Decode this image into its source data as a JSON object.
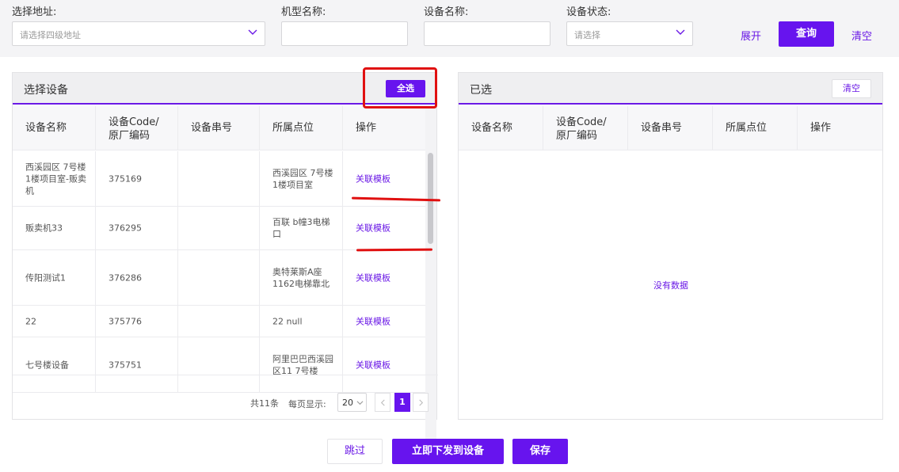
{
  "filters": {
    "address": {
      "label": "选择地址:",
      "placeholder": "请选择四级地址"
    },
    "model": {
      "label": "机型名称:",
      "value": ""
    },
    "device_name": {
      "label": "设备名称:",
      "value": ""
    },
    "status": {
      "label": "设备状态:",
      "placeholder": "请选择"
    },
    "expand_label": "展开",
    "query_label": "查询",
    "clear_label": "清空"
  },
  "left_panel": {
    "title": "选择设备",
    "select_all_label": "全选",
    "columns": [
      "设备名称",
      "设备Code/\n原厂编码",
      "设备串号",
      "所属点位",
      "操作"
    ],
    "rows": [
      {
        "name": "西溪园区 7号楼1楼项目室-贩卖机",
        "code": "375169",
        "serial": "",
        "location": "西溪园区 7号楼1楼项目室",
        "action": "关联模板"
      },
      {
        "name": "贩卖机33",
        "code": "376295",
        "serial": "",
        "location": "百联 b幢3电梯口",
        "action": "关联模板"
      },
      {
        "name": "传阳测试1",
        "code": "376286",
        "serial": "",
        "location": "奥特莱斯A座1162电梯靠北",
        "action": "关联模板"
      },
      {
        "name": "22",
        "code": "375776",
        "serial": "",
        "location": "22 null",
        "action": "关联模板"
      },
      {
        "name": "七号楼设备",
        "code": "375751",
        "serial": "",
        "location": "阿里巴巴西溪园区11 7号楼",
        "action": "关联模板"
      }
    ],
    "pagination": {
      "total_text": "共11条",
      "page_size_label": "每页显示:",
      "page_size": "20",
      "current_page": "1"
    }
  },
  "right_panel": {
    "title": "已选",
    "clear_label": "清空",
    "columns": [
      "设备名称",
      "设备Code/\n原厂编码",
      "设备串号",
      "所属点位",
      "操作"
    ],
    "empty_text": "没有数据"
  },
  "footer": {
    "skip_label": "跳过",
    "send_label": "立即下发到设备",
    "save_label": "保存"
  },
  "colors": {
    "accent": "#6714ee",
    "annotation": "#e01010"
  },
  "icons": [
    "chevron-down-icon",
    "chevron-left-icon",
    "chevron-right-icon"
  ]
}
